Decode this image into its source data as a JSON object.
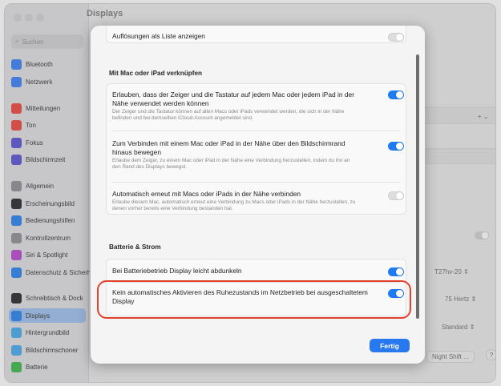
{
  "window": {
    "title": "Displays",
    "search_placeholder": "Suchen"
  },
  "sidebar": {
    "items": [
      {
        "label": "Bluetooth",
        "color": "#4f8ef7"
      },
      {
        "label": "Netzwerk",
        "color": "#4f8ef7"
      },
      {
        "label": "Mitteilungen",
        "color": "#ef5a52"
      },
      {
        "label": "Ton",
        "color": "#ef5a52"
      },
      {
        "label": "Fokus",
        "color": "#6b63d8"
      },
      {
        "label": "Bildschirmzeit",
        "color": "#6b63d8"
      },
      {
        "label": "Allgemein",
        "color": "#9a9aa0"
      },
      {
        "label": "Erscheinungsbild",
        "color": "#3d3d42"
      },
      {
        "label": "Bedienungshilfen",
        "color": "#3f8ff0"
      },
      {
        "label": "Kontrollzentrum",
        "color": "#9a9aa0"
      },
      {
        "label": "Siri & Spotlight",
        "color": "#c05ad6"
      },
      {
        "label": "Datenschutz & Sicherheit",
        "color": "#3f8ff0"
      },
      {
        "label": "Schreibtisch & Dock",
        "color": "#3d3d42"
      },
      {
        "label": "Displays",
        "color": "#3f8ff0"
      },
      {
        "label": "Hintergrundbild",
        "color": "#5ab2f0"
      },
      {
        "label": "Bildschirmschoner",
        "color": "#5ab2f0"
      },
      {
        "label": "Batterie",
        "color": "#4fc25a"
      }
    ],
    "selected": "Displays"
  },
  "background": {
    "add_button": "+ ⌄",
    "resolution_value": "T27hv-20 ⇕",
    "refresh_value": "75 Hertz ⇕",
    "color_value": "Standard ⇕",
    "night_shift_button": "Night Shift ...",
    "help_button": "?"
  },
  "sheet": {
    "top_row": {
      "title": "Auflösungen als Liste anzeigen",
      "enabled": false
    },
    "section_link": {
      "heading": "Mit Mac oder iPad verknüpfen",
      "rows": [
        {
          "title": "Erlauben, dass der Zeiger und die Tastatur auf jedem Mac oder jedem iPad in der Nähe verwendet werden können",
          "desc": "Der Zeiger und die Tastatur können auf allen Macs oder iPads verwendet werden, die sich in der Nähe befinden und bei demselben iCloud-Account angemeldet sind.",
          "enabled": true
        },
        {
          "title": "Zum Verbinden mit einem Mac oder iPad in der Nähe über den Bildschirmrand hinaus bewegen",
          "desc": "Erlaube dem Zeiger, zu einem Mac oder iPad in der Nähe eine Verbindung herzustellen, indem du ihn an den Rand des Displays bewegst.",
          "enabled": true
        },
        {
          "title": "Automatisch erneut mit Macs oder iPads in der Nähe verbinden",
          "desc": "Erlaube diesem Mac, automatisch erneut eine Verbindung zu Macs oder iPads in der Nähe herzustellen, zu denen vorher bereits eine Verbindung bestanden hat.",
          "enabled": false
        }
      ]
    },
    "section_battery": {
      "heading": "Batterie & Strom",
      "rows": [
        {
          "title": "Bei Batteriebetrieb Display leicht abdunkeln",
          "enabled": true
        },
        {
          "title": "Kein automatisches Aktivieren des Ruhezustands im Netzbetrieb bei ausgeschaltetem Display",
          "enabled": true
        }
      ]
    },
    "done_label": "Fertig"
  },
  "colors": {
    "accent": "#1f7bf2",
    "highlight": "#e2412e"
  }
}
